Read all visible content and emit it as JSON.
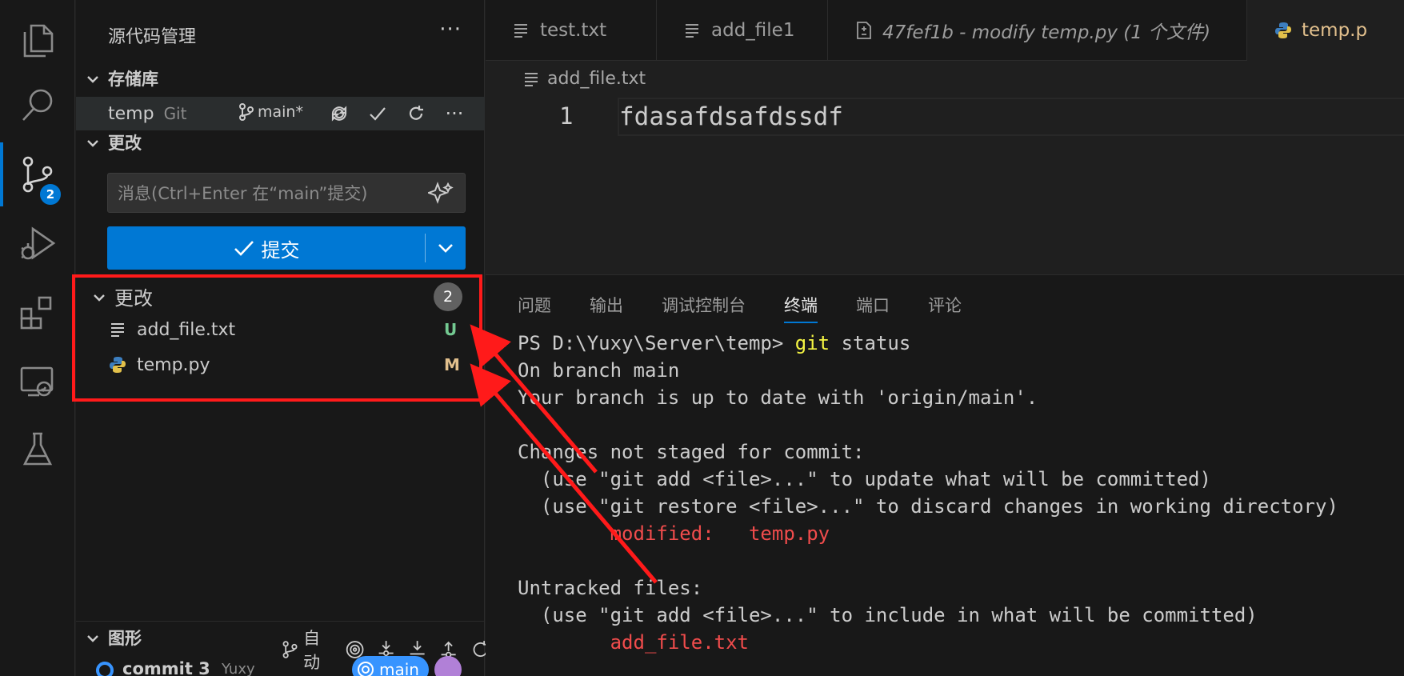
{
  "activity_bar": {
    "items": [
      {
        "name": "explorer-icon"
      },
      {
        "name": "search-icon"
      },
      {
        "name": "source-control-icon",
        "badge": "2"
      },
      {
        "name": "run-debug-icon"
      },
      {
        "name": "extensions-icon"
      },
      {
        "name": "remote-explorer-icon"
      },
      {
        "name": "testing-icon"
      }
    ]
  },
  "sidebar": {
    "title": "源代码管理",
    "more": "···",
    "repositories_label": "存储库",
    "repo": {
      "name": "temp",
      "type": "Git",
      "branch": "main*"
    },
    "changes_section_label": "更改",
    "message_placeholder": "消息(Ctrl+Enter 在“main”提交)",
    "commit_label": "提交",
    "changes_group_label": "更改",
    "changes_count": "2",
    "files": [
      {
        "name": "add_file.txt",
        "status": "U",
        "icon": "text-file-icon"
      },
      {
        "name": "temp.py",
        "status": "M",
        "icon": "python-file-icon"
      }
    ],
    "graph": {
      "label": "图形",
      "auto_label": "自动",
      "commit_message": "commit 3",
      "commit_author": "Yuxy",
      "branch_tag": "main"
    }
  },
  "editor": {
    "tabs": [
      {
        "label": "test.txt"
      },
      {
        "label": "add_file1"
      },
      {
        "label": "47fef1b - modify temp.py (1 个文件)"
      },
      {
        "label": "temp.p"
      }
    ],
    "breadcrumb": "add_file.txt",
    "line_number": "1",
    "line_text": "fdasafdsafdssdf"
  },
  "panel": {
    "tabs": [
      "问题",
      "输出",
      "调试控制台",
      "终端",
      "端口",
      "评论"
    ],
    "active_tab": "终端",
    "terminal": {
      "prompt": "PS D:\\Yuxy\\Server\\temp> ",
      "cmd_git": "git",
      "cmd_rest": " status",
      "l2": "On branch main",
      "l3": "Your branch is up to date with 'origin/main'.",
      "l5": "Changes not staged for commit:",
      "l6": "  (use \"git add <file>...\" to update what will be committed)",
      "l7": "  (use \"git restore <file>...\" to discard changes in working directory)",
      "l8": "        modified:   temp.py",
      "l10": "Untracked files:",
      "l11": "  (use \"git add <file>...\" to include in what will be committed)",
      "l12": "        add_file.txt"
    }
  },
  "colors": {
    "accent": "#0078d4",
    "annotation": "#ff1a1a",
    "untracked": "#73c991",
    "modified": "#e2c08d"
  }
}
